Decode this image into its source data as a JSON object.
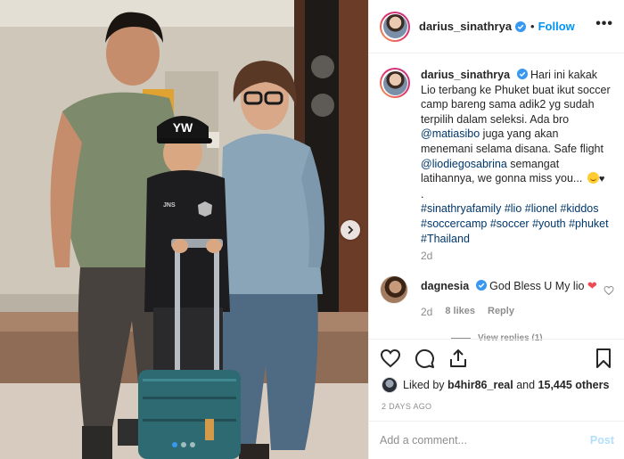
{
  "post": {
    "author": "darius_sinathrya",
    "follow_label": "Follow",
    "separator": "•",
    "more_label": "•••"
  },
  "caption": {
    "author": "darius_sinathrya",
    "text_1": "Hari ini kakak Lio terbang ke Phuket buat ikut soccer camp bareng sama adik2 yg sudah terpilih dalam seleksi. Ada bro",
    "mention_1": "@matiasibo",
    "text_2": "juga yang akan menemani selama disana. Safe flight",
    "mention_2": "@liodiegosabrina",
    "text_3": "semangat latihannya, we gonna miss you...",
    "emoji": "smiling-face-emoji",
    "heart": "♥",
    "dot": ".",
    "hashtags": [
      "#sinathryafamily",
      "#lio",
      "#lionel",
      "#kiddos",
      "#soccercamp",
      "#soccer",
      "#youth",
      "#phuket",
      "#Thailand"
    ],
    "time": "2d"
  },
  "comment": {
    "author": "dagnesia",
    "text": "God Bless U My lio",
    "heart": "❤",
    "time": "2d",
    "likes": "8 likes",
    "reply": "Reply",
    "view_replies": "View replies (1)"
  },
  "actions": {
    "liked_by_prefix": "Liked by",
    "liked_by_user": "b4hir86_real",
    "liked_by_and": "and",
    "liked_by_count": "15,445 others",
    "date": "2 DAYS AGO"
  },
  "add_comment": {
    "placeholder": "Add a comment...",
    "post_label": "Post"
  },
  "carousel": {
    "slide_count": 3,
    "active_slide": 1
  },
  "photo": {
    "cap_text": "YW",
    "jacket_text": "JNS"
  },
  "colors": {
    "accent": "#0095f6",
    "verified": "#3897f0",
    "heart": "#ed4956",
    "muted": "#8e8e8e",
    "link": "#00376b"
  }
}
